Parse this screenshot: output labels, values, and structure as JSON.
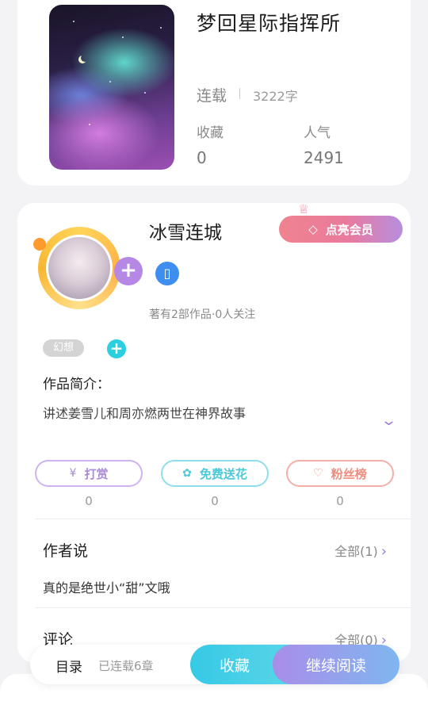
{
  "book": {
    "title": "梦回星际指挥所",
    "status": "连载",
    "word_count": "3222字",
    "stats": {
      "favorites_label": "收藏",
      "favorites_value": "0",
      "popularity_label": "人气",
      "popularity_value": "2491"
    }
  },
  "author": {
    "name": "冰雪连城",
    "vip_button": "点亮会员",
    "stats_text": "著有2部作品·0人关注",
    "genre_tag": "幻想",
    "intro_heading": "作品简介：",
    "intro_text": "讲述姜雪儿和周亦燃两世在神界故事"
  },
  "actions": {
    "reward_label": "打赏",
    "reward_count": "0",
    "flower_label": "免费送花",
    "flower_count": "0",
    "fans_label": "粉丝榜",
    "fans_count": "0"
  },
  "author_says": {
    "heading": "作者说",
    "all_label": "全部(1)",
    "text": "真的是绝世小“甜”文哦"
  },
  "comments": {
    "heading": "评论",
    "all_label": "全部(0)"
  },
  "bottom_bar": {
    "toc_label": "目录",
    "chapters_label": "已连载6章",
    "collect_label": "收藏",
    "continue_label": "继续阅读"
  },
  "icons": {
    "reward": "yen-icon",
    "flower": "flower-icon",
    "fans": "user-heart-icon",
    "vip": "diamond-icon",
    "badge": "phone-badge-icon"
  },
  "colors": {
    "accent_purple": "#b688e6",
    "accent_cyan": "#36c9e6",
    "vip_pink": "#f0838f"
  }
}
